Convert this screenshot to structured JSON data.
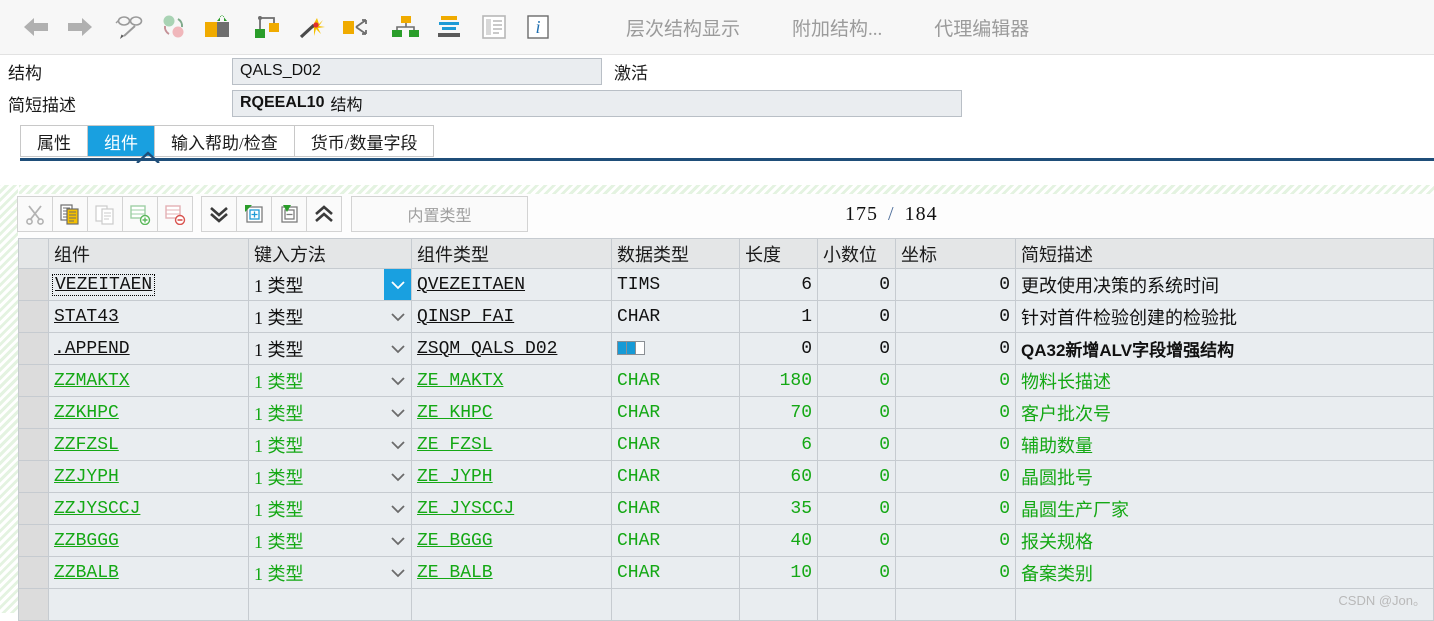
{
  "toolbar": {
    "icons": [
      {
        "name": "back-arrow-icon"
      },
      {
        "name": "forward-arrow-icon"
      },
      {
        "name": "glasses-pencil-icon"
      },
      {
        "name": "refresh-circles-icon"
      },
      {
        "name": "package-transport-icon"
      },
      {
        "name": "hierarchy-build-icon"
      },
      {
        "name": "magic-wand-icon"
      },
      {
        "name": "where-used-icon"
      },
      {
        "name": "structure-tree-icon"
      },
      {
        "name": "stack-layers-icon"
      },
      {
        "name": "documentation-icon"
      },
      {
        "name": "info-icon"
      }
    ],
    "buttons": [
      {
        "label": "层次结构显示",
        "name": "hierarchy-display-button"
      },
      {
        "label": "附加结构...",
        "name": "append-structure-button"
      },
      {
        "label": "代理编辑器",
        "name": "proxy-editor-button"
      }
    ]
  },
  "header": {
    "structure_label": "结构",
    "structure_value": "QALS_D02",
    "status": "激活",
    "description_label": "简短描述",
    "description_value": "RQEEAL10",
    "description_suffix": "结构"
  },
  "tabs": [
    {
      "label": "属性",
      "active": false
    },
    {
      "label": "组件",
      "active": true
    },
    {
      "label": "输入帮助/检查",
      "active": false
    },
    {
      "label": "货币/数量字段",
      "active": false
    }
  ],
  "grid_toolbar": {
    "icons": [
      {
        "name": "cut-icon"
      },
      {
        "name": "copy-icon"
      },
      {
        "name": "paste-icon"
      },
      {
        "name": "insert-row-icon"
      },
      {
        "name": "delete-row-icon"
      },
      {
        "name": "scroll-down-icon"
      },
      {
        "name": "insert-after-icon"
      },
      {
        "name": "insert-before-icon"
      },
      {
        "name": "scroll-up-icon"
      }
    ],
    "builtin_type_label": "内置类型",
    "counter_current": "175",
    "counter_separator": "/",
    "counter_total": "184"
  },
  "table": {
    "columns": [
      "组件",
      "键入方法",
      "组件类型",
      "数据类型",
      "长度",
      "小数位",
      "坐标",
      "简短描述"
    ],
    "key_method_label": "1 类型",
    "rows": [
      {
        "component": "VEZEITAEN",
        "key_method": "1 类型",
        "component_type": "QVEZEITAEN",
        "data_type": "TIMS",
        "length": "6",
        "decimals": "0",
        "coord": "0",
        "description": "更改使用决策的系统时间",
        "green": false,
        "selected": true,
        "dropdown_active": true,
        "struct_icon": false,
        "bold_desc": false
      },
      {
        "component": "STAT43",
        "key_method": "1 类型",
        "component_type": "QINSP_FAI",
        "data_type": "CHAR",
        "length": "1",
        "decimals": "0",
        "coord": "0",
        "description": "针对首件检验创建的检验批",
        "green": false,
        "selected": false,
        "dropdown_active": false,
        "struct_icon": false,
        "bold_desc": false
      },
      {
        "component": ".APPEND",
        "key_method": "1 类型",
        "component_type": "ZSQM_QALS_D02",
        "data_type": "",
        "length": "0",
        "decimals": "0",
        "coord": "0",
        "description": "QA32新增ALV字段增强结构",
        "green": false,
        "selected": false,
        "dropdown_active": false,
        "struct_icon": true,
        "bold_desc": true
      },
      {
        "component": "ZZMAKTX",
        "key_method": "1 类型",
        "component_type": "ZE_MAKTX",
        "data_type": "CHAR",
        "length": "180",
        "decimals": "0",
        "coord": "0",
        "description": "物料长描述",
        "green": true,
        "selected": false,
        "dropdown_active": false,
        "struct_icon": false,
        "bold_desc": false
      },
      {
        "component": "ZZKHPC",
        "key_method": "1 类型",
        "component_type": "ZE_KHPC",
        "data_type": "CHAR",
        "length": "70",
        "decimals": "0",
        "coord": "0",
        "description": "客户批次号",
        "green": true,
        "selected": false,
        "dropdown_active": false,
        "struct_icon": false,
        "bold_desc": false
      },
      {
        "component": "ZZFZSL",
        "key_method": "1 类型",
        "component_type": "ZE_FZSL",
        "data_type": "CHAR",
        "length": "6",
        "decimals": "0",
        "coord": "0",
        "description": "辅助数量",
        "green": true,
        "selected": false,
        "dropdown_active": false,
        "struct_icon": false,
        "bold_desc": false
      },
      {
        "component": "ZZJYPH",
        "key_method": "1 类型",
        "component_type": "ZE_JYPH",
        "data_type": "CHAR",
        "length": "60",
        "decimals": "0",
        "coord": "0",
        "description": "晶圆批号",
        "green": true,
        "selected": false,
        "dropdown_active": false,
        "struct_icon": false,
        "bold_desc": false
      },
      {
        "component": "ZZJYSCCJ",
        "key_method": "1 类型",
        "component_type": "ZE_JYSCCJ",
        "data_type": "CHAR",
        "length": "35",
        "decimals": "0",
        "coord": "0",
        "description": "晶圆生产厂家",
        "green": true,
        "selected": false,
        "dropdown_active": false,
        "struct_icon": false,
        "bold_desc": false
      },
      {
        "component": "ZZBGGG",
        "key_method": "1 类型",
        "component_type": "ZE_BGGG",
        "data_type": "CHAR",
        "length": "40",
        "decimals": "0",
        "coord": "0",
        "description": "报关规格",
        "green": true,
        "selected": false,
        "dropdown_active": false,
        "struct_icon": false,
        "bold_desc": false
      },
      {
        "component": "ZZBALB",
        "key_method": "1 类型",
        "component_type": "ZE_BALB",
        "data_type": "CHAR",
        "length": "10",
        "decimals": "0",
        "coord": "0",
        "description": "备案类别",
        "green": true,
        "selected": false,
        "dropdown_active": false,
        "struct_icon": false,
        "bold_desc": false
      },
      {
        "component": "",
        "key_method": "",
        "component_type": "",
        "data_type": "",
        "length": "",
        "decimals": "",
        "coord": "",
        "description": "",
        "green": false,
        "selected": false,
        "dropdown_active": false,
        "struct_icon": false,
        "bold_desc": false
      }
    ]
  },
  "watermark": "CSDN @Jon。"
}
